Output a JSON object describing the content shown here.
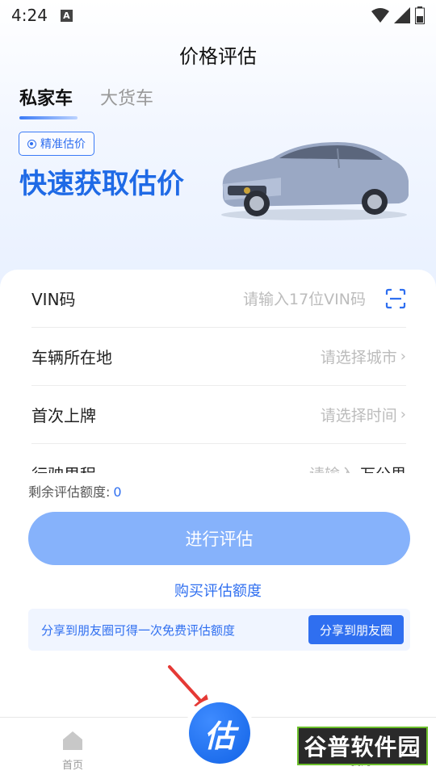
{
  "status_bar": {
    "time": "4:24",
    "notification_icon": "A"
  },
  "header": {
    "title": "价格评估"
  },
  "tabs": [
    {
      "label": "私家车",
      "active": true
    },
    {
      "label": "大货车",
      "active": false
    }
  ],
  "hero": {
    "badge": "精准估价",
    "headline": "快速获取估价"
  },
  "form": {
    "vin": {
      "label": "VIN码",
      "placeholder": "请输入17位VIN码"
    },
    "location": {
      "label": "车辆所在地",
      "placeholder": "请选择城市"
    },
    "first_reg": {
      "label": "首次上牌",
      "placeholder": "请选择时间"
    },
    "mileage": {
      "label": "行驶里程",
      "placeholder": "请输入",
      "unit": "万公里"
    }
  },
  "quota": {
    "label": "剩余评估额度:",
    "value": "0"
  },
  "actions": {
    "evaluate": "进行评估",
    "buy_quota": "购买评估额度"
  },
  "share": {
    "text": "分享到朋友圈可得一次免费评估额度",
    "button": "分享到朋友圈"
  },
  "bottom_nav": {
    "home": "首页",
    "fab": "估",
    "right": "我的"
  },
  "watermark": {
    "text": "谷普软件园"
  },
  "colors": {
    "accent": "#2f6ff0",
    "button_disabled": "#86b2fb",
    "highlight_arrow": "#e53935"
  }
}
